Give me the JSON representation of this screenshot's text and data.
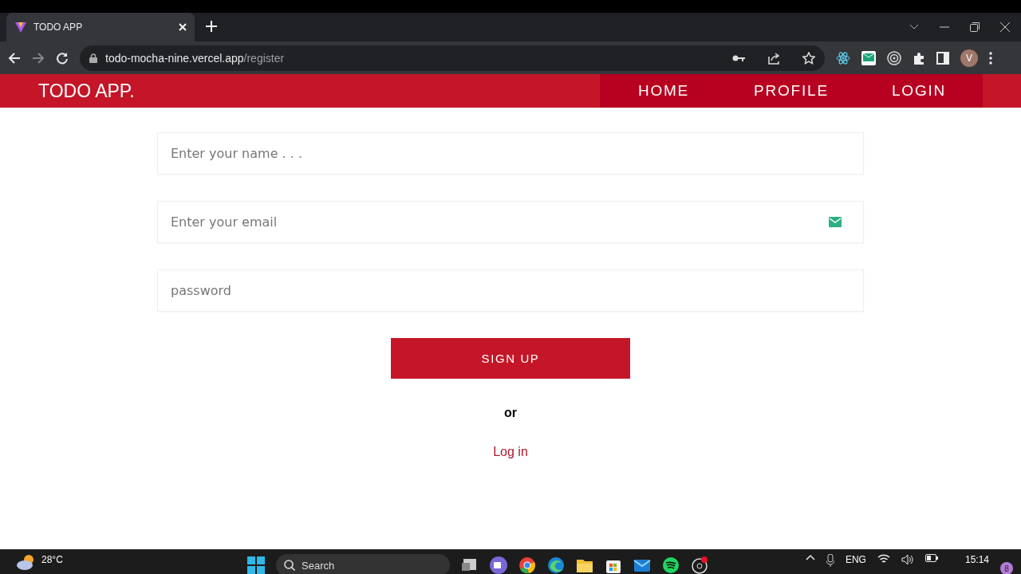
{
  "browser": {
    "tab": {
      "title": "TODO APP"
    },
    "address": {
      "host": "todo-mocha-nine.vercel.app",
      "path": "/register"
    },
    "avatar": "V"
  },
  "navbar": {
    "brand": "TODO APP.",
    "links": [
      {
        "label": "HOME"
      },
      {
        "label": "PROFILE"
      },
      {
        "label": "LOGIN"
      }
    ]
  },
  "form": {
    "fields": [
      {
        "kind": "text",
        "placeholder": "Enter your name . . ."
      },
      {
        "kind": "email",
        "placeholder": "Enter your email"
      },
      {
        "kind": "password",
        "placeholder": "password"
      }
    ],
    "submit": "SIGN UP",
    "separator": "or",
    "alt_link": "Log in"
  },
  "taskbar": {
    "weather": "28°C",
    "search": "Search",
    "language": "ENG",
    "time": "15:14",
    "notifications": "8"
  }
}
